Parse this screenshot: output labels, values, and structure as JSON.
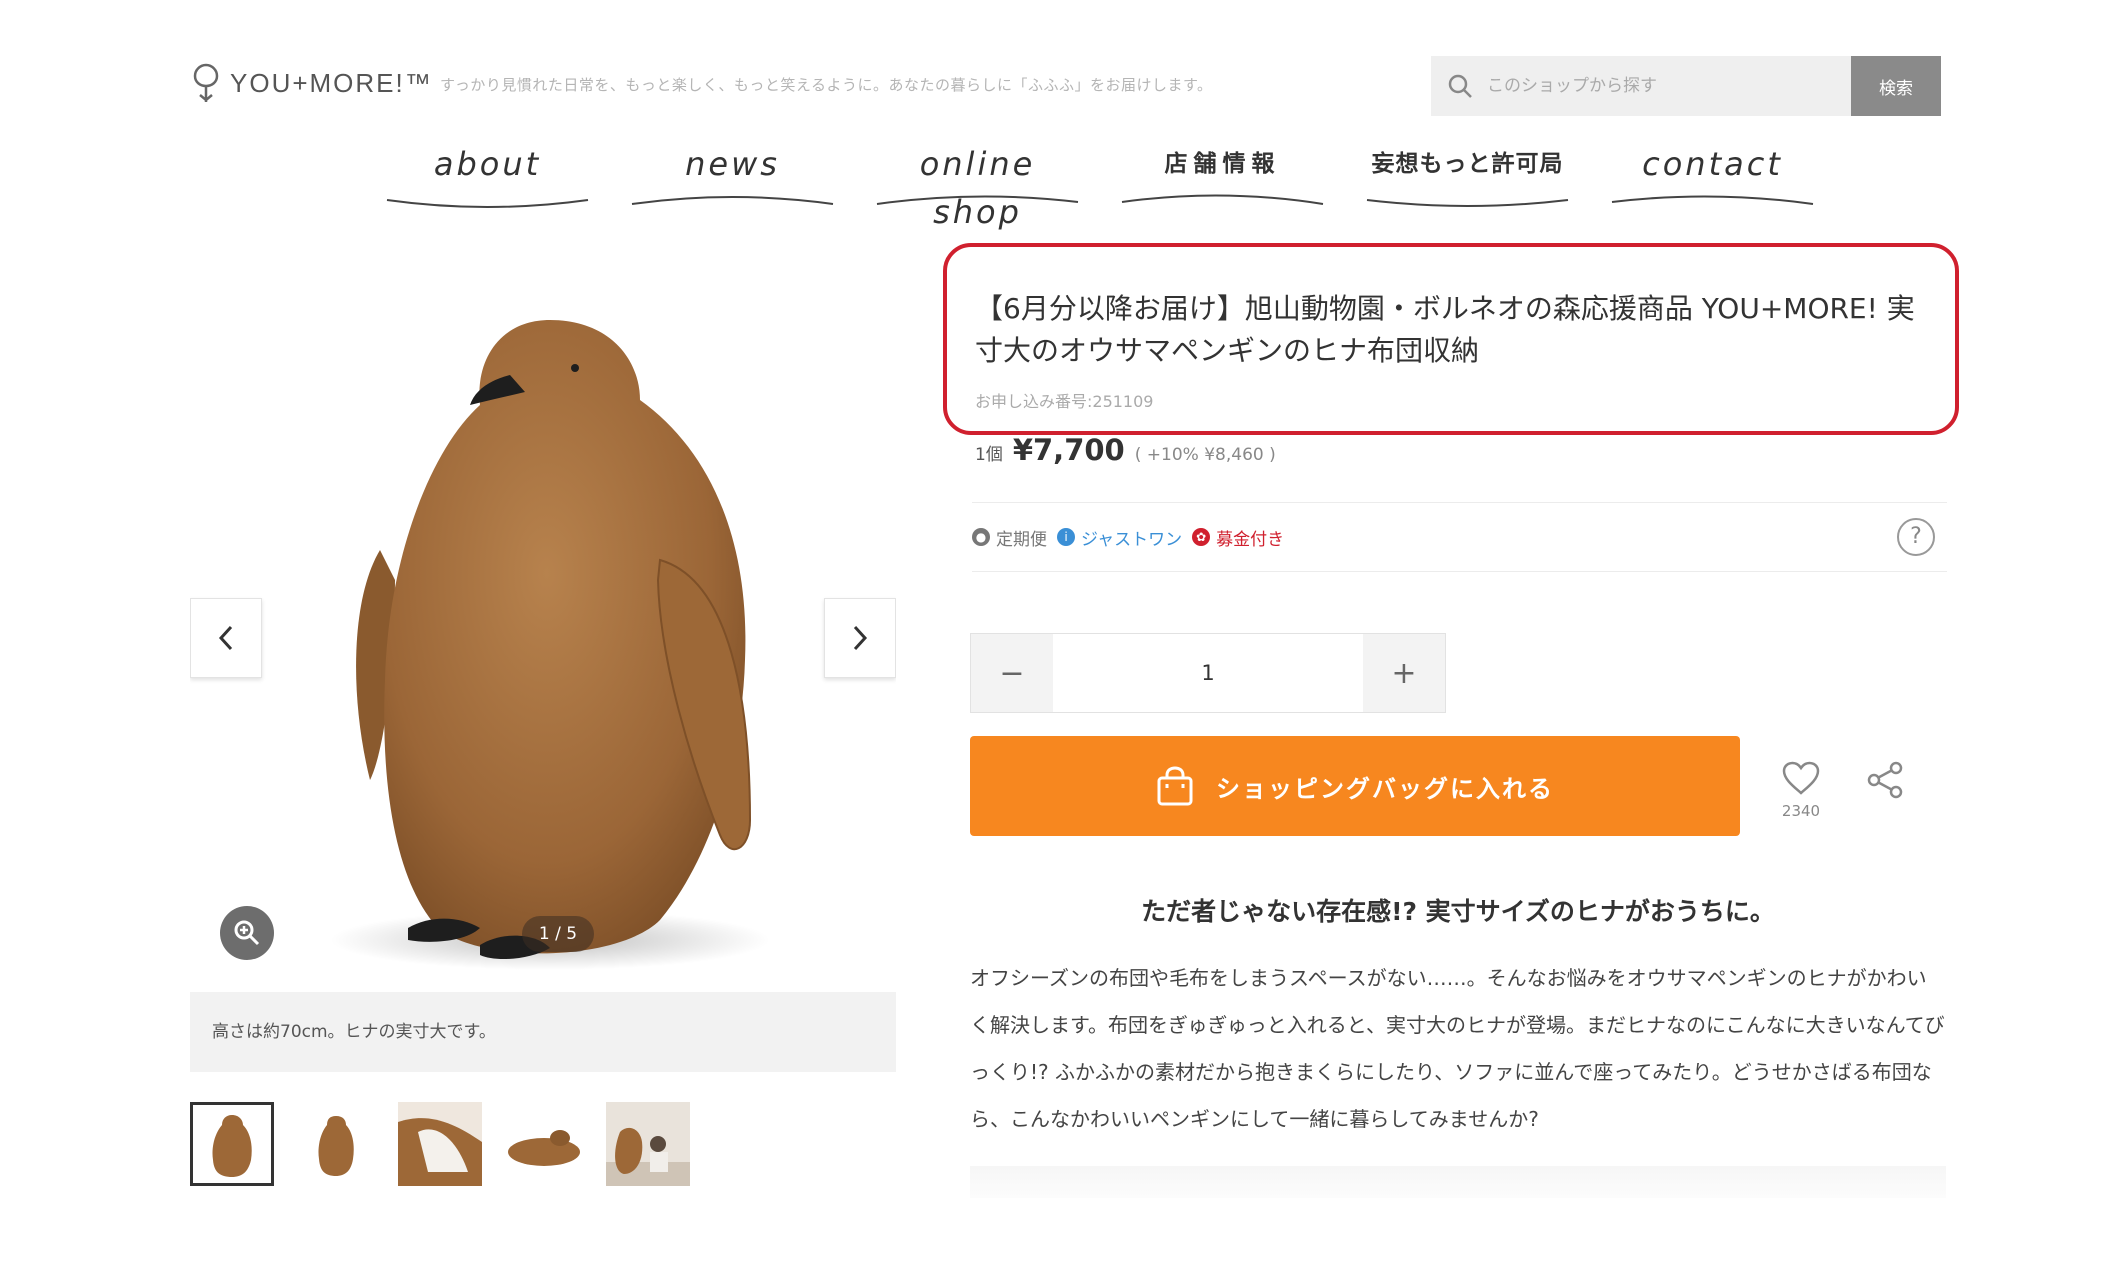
{
  "header": {
    "logo_text": "YOU+MORE!™",
    "tagline": "すっかり見慣れた日常を、もっと楽しく、もっと笑えるように。あなたの暮らしに「ふふふ」をお届けします。",
    "search": {
      "placeholder": "このショップから探す",
      "button_label": "検索"
    }
  },
  "nav": {
    "items": [
      {
        "label": "about"
      },
      {
        "label": "news"
      },
      {
        "label": "online shop"
      },
      {
        "label": "店舗情報"
      },
      {
        "label": "妄想もっと許可局"
      },
      {
        "label": "contact"
      }
    ]
  },
  "gallery": {
    "counter": "1 / 5",
    "caption": "高さは約70cm。ヒナの実寸大です。",
    "thumb_count": 5,
    "active_index": 0
  },
  "product": {
    "title": "【6月分以降お届け】旭山動物園・ボルネオの森応援商品 YOU+MORE! 実寸大のオウサマペンギンのヒナ布団収納",
    "id_label": "お申し込み番号:251109",
    "price_unit": "1個",
    "price": "¥7,700",
    "price_tax": "( +10% ¥8,460 )",
    "badges": [
      {
        "label": "定期便",
        "color": "#777777",
        "icon": "circle-icon"
      },
      {
        "label": "ジャストワン",
        "color": "#3a8fd6",
        "icon": "info-icon"
      },
      {
        "label": "募金付き",
        "color": "#d0202e",
        "icon": "flower-icon"
      }
    ],
    "help_label": "?",
    "quantity": "1",
    "qty_minus": "−",
    "qty_plus": "+",
    "cart_label": "ショッピングバッグに入れる",
    "fav_count": "2340",
    "headline": "ただ者じゃない存在感!? 実寸サイズのヒナがおうちに。",
    "description": "オフシーズンの布団や毛布をしまうスペースがない……。そんなお悩みをオウサマペンギンのヒナがかわいく解決します。布団をぎゅぎゅっと入れると、実寸大のヒナが登場。まだヒナなのにこんなに大きいなんてびっくり!? ふかふかの素材だから抱きまくらにしたり、ソファに並んで座ってみたり。どうせかさばる布団なら、こんなかわいいペンギンにして一緒に暮らしてみませんか?"
  },
  "colors": {
    "accent": "#f7871f",
    "highlight_border": "#d0202e",
    "penguin_brown": "#a6713f"
  }
}
